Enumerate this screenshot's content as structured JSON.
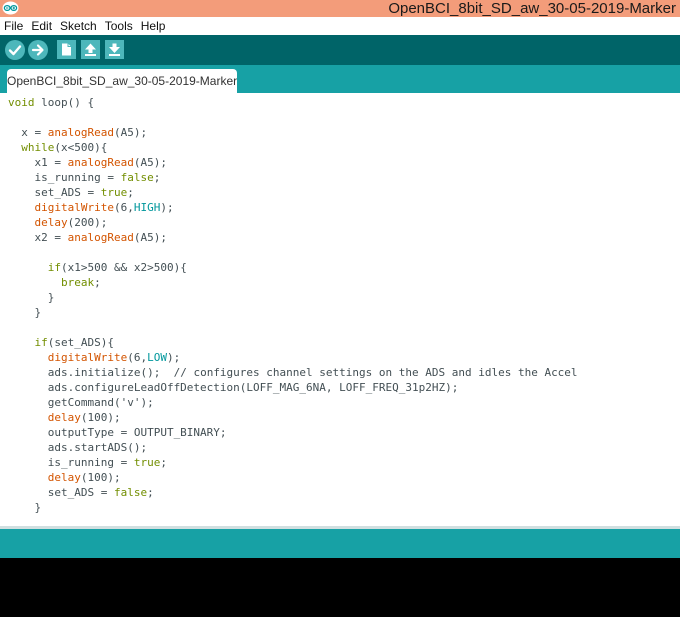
{
  "window": {
    "title": "OpenBCI_8bit_SD_aw_30-05-2019-Marker"
  },
  "menu": {
    "items": [
      "File",
      "Edit",
      "Sketch",
      "Tools",
      "Help"
    ]
  },
  "toolbar": {
    "buttons": [
      "verify-icon",
      "upload-icon",
      "new-icon",
      "open-icon",
      "save-icon"
    ]
  },
  "tabs": [
    {
      "label": "OpenBCI_8bit_SD_aw_30-05-2019-Marker",
      "active": true
    }
  ],
  "colors": {
    "titlebar": "#f39c7a",
    "toolbar": "#006468",
    "tabbar": "#17a1a5",
    "button": "#4db7bb",
    "keyword": "#728e00",
    "function": "#d35400",
    "constant": "#00979c",
    "text": "#434f54",
    "console": "#000000"
  },
  "code": {
    "lines": [
      "void loop() {",
      "",
      "  x = analogRead(A5);",
      "  while(x<500){",
      "    x1 = analogRead(A5);",
      "    is_running = false;",
      "    set_ADS = true;",
      "    digitalWrite(6,HIGH);",
      "    delay(200);",
      "    x2 = analogRead(A5);",
      "",
      "      if(x1>500 && x2>500){",
      "        break;",
      "      }",
      "    }",
      "",
      "    if(set_ADS){",
      "      digitalWrite(6,LOW);",
      "      ads.initialize();  // configures channel settings on the ADS and idles the Accel",
      "      ads.configureLeadOffDetection(LOFF_MAG_6NA, LOFF_FREQ_31p2HZ);",
      "      getCommand('v');",
      "      delay(100);",
      "      outputType = OUTPUT_BINARY;",
      "      ads.startADS();",
      "      is_running = true;",
      "      delay(100);",
      "      set_ADS = false;",
      "    }"
    ]
  }
}
